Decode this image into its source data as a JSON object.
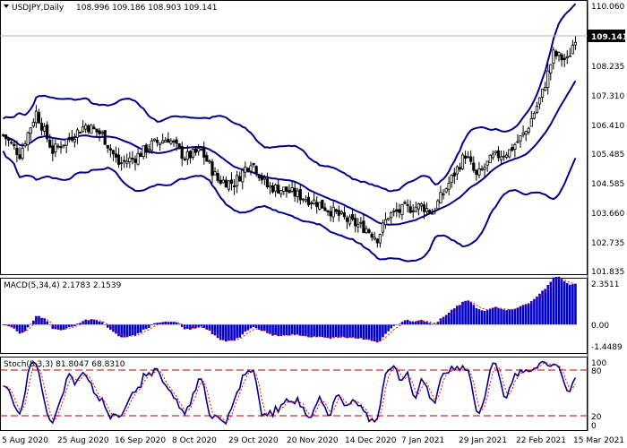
{
  "header": {
    "symbol_timeframe": "USDJPY,Daily",
    "ohlc": "108.996 109.186 108.903 109.141"
  },
  "price_panel": {
    "y_ticks": [
      "110.060",
      "109.141",
      "108.235",
      "107.310",
      "106.410",
      "105.485",
      "104.585",
      "103.660",
      "102.735",
      "101.835"
    ],
    "current_price": "109.141"
  },
  "macd_panel": {
    "title": "MACD(5,34,4) 2.1783 2.1539",
    "y_ticks": [
      "2.3511",
      "0.00",
      "-1.4489"
    ]
  },
  "stoch_panel": {
    "title": "Stoch(5,3,3) 81.8047 68.8310",
    "y_ticks": [
      "100",
      "80",
      "20",
      "0"
    ]
  },
  "x_axis": {
    "dates": [
      "5 Aug 2020",
      "25 Aug 2020",
      "16 Sep 2020",
      "8 Oct 2020",
      "29 Oct 2020",
      "20 Nov 2020",
      "14 Dec 2020",
      "7 Jan 2021",
      "29 Jan 2021",
      "22 Feb 2021",
      "15 Mar 2021"
    ]
  },
  "colors": {
    "candle": "#000000",
    "bollinger": "#00008b",
    "macd_histogram": "#0000cd",
    "macd_signal": "#ff0000",
    "stoch_main": "#00008b",
    "stoch_signal": "#ff0000",
    "level_line": "#c00000",
    "price_label_bg": "#000000"
  },
  "chart_data": {
    "type": "line",
    "title": "USDJPY,Daily",
    "x": [
      "5 Aug 2020",
      "25 Aug 2020",
      "16 Sep 2020",
      "8 Oct 2020",
      "29 Oct 2020",
      "20 Nov 2020",
      "14 Dec 2020",
      "7 Jan 2021",
      "29 Jan 2021",
      "22 Feb 2021",
      "15 Mar 2021"
    ],
    "series": [
      {
        "name": "",
        "values": [
          105.9,
          106.3,
          105.1,
          105.6,
          104.6,
          103.9,
          103.4,
          103.8,
          104.9,
          106.0,
          109.1
        ]
      }
    ],
    "ylim": [
      101.835,
      110.06
    ],
    "ohlc_last": {
      "open": 108.996,
      "high": 109.186,
      "low": 108.903,
      "close": 109.141
    },
    "macd": {
      "params": "5,34,4",
      "main": 2.1783,
      "signal": 2.1539,
      "ylim": [
        -1.4489,
        2.3511
      ]
    },
    "stochastic": {
      "params": "5,3,3",
      "k": 81.8047,
      "d": 68.831,
      "levels": [
        20,
        80
      ],
      "ylim": [
        0,
        100
      ]
    },
    "grid": false,
    "legend": "none"
  }
}
